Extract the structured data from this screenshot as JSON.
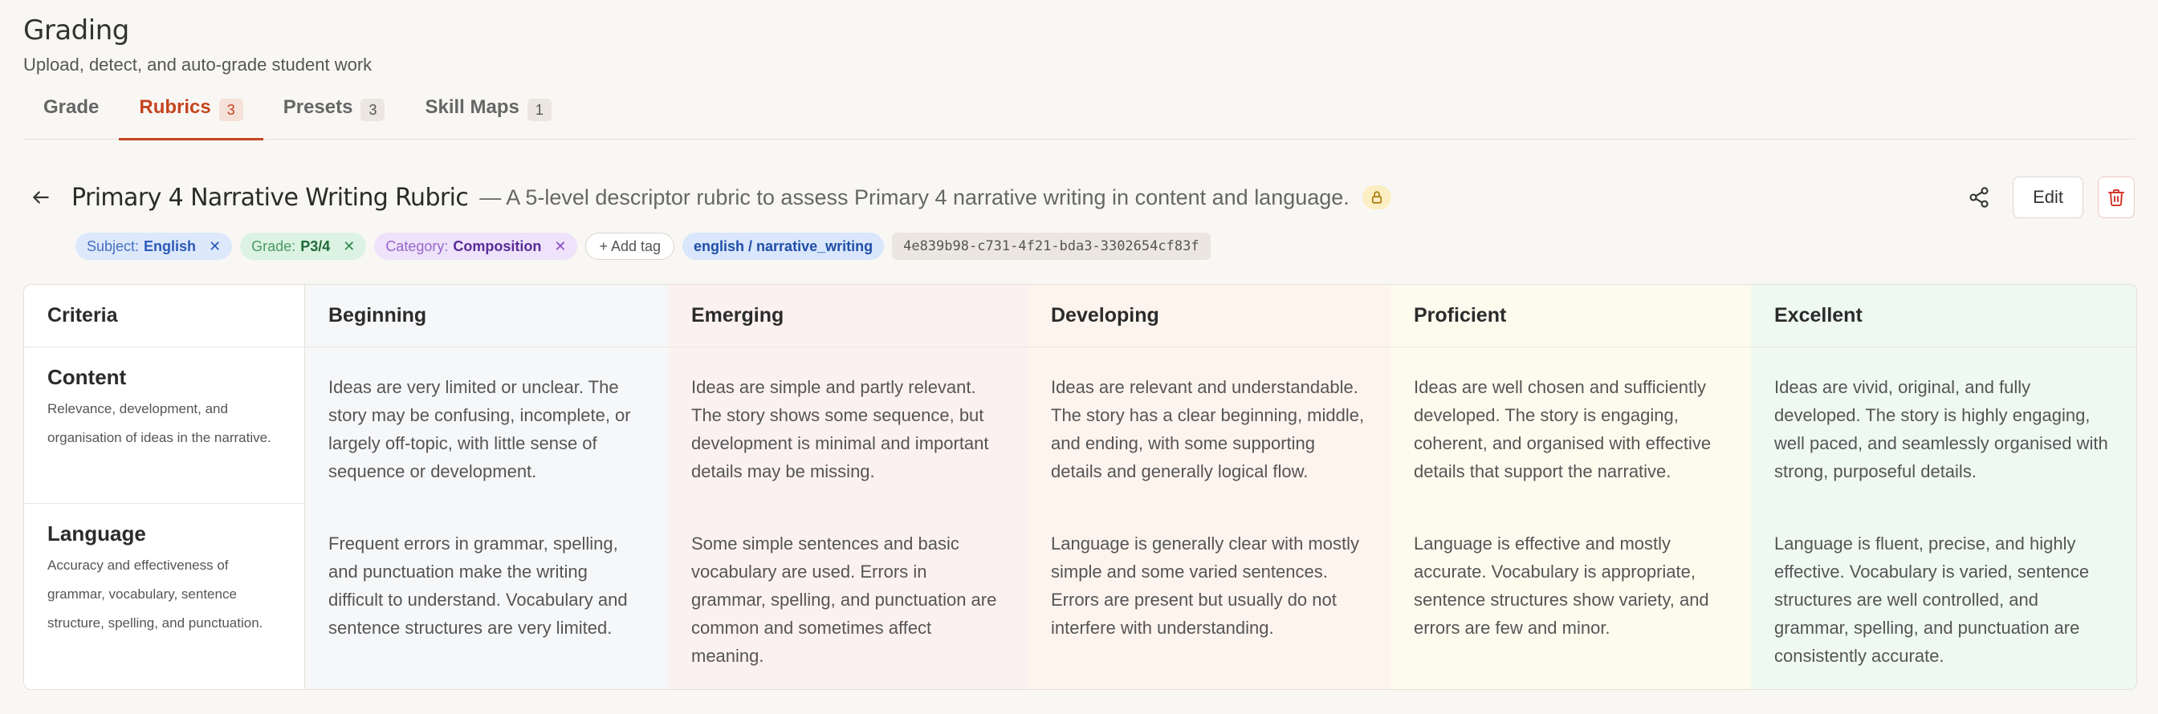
{
  "app": {
    "title": "Grading",
    "subtitle": "Upload, detect, and auto-grade student work"
  },
  "tabs": [
    {
      "label": "Grade",
      "count": null,
      "active": false
    },
    {
      "label": "Rubrics",
      "count": "3",
      "active": true
    },
    {
      "label": "Presets",
      "count": "3",
      "active": false
    },
    {
      "label": "Skill Maps",
      "count": "1",
      "active": false
    }
  ],
  "rubric": {
    "title": "Primary 4 Narrative Writing Rubric",
    "description": "— A 5-level descriptor rubric to assess Primary 4 narrative writing in content and language.",
    "edit_label": "Edit"
  },
  "tags": {
    "subject": {
      "key": "Subject:",
      "value": "English"
    },
    "grade": {
      "key": "Grade:",
      "value": "P3/4"
    },
    "category": {
      "key": "Category:",
      "value": "Composition"
    },
    "add_label": "+ Add tag",
    "path": "english / narrative_writing",
    "uuid": "4e839b98-c731-4f21-bda3-3302654cf83f"
  },
  "table": {
    "headers": [
      "Criteria",
      "Beginning",
      "Emerging",
      "Developing",
      "Proficient",
      "Excellent"
    ],
    "rows": [
      {
        "name": "Content",
        "description": "Relevance, development, and organisation of ideas in the narrative.",
        "cells": [
          "Ideas are very limited or unclear. The story may be confusing, incomplete, or largely off-topic, with little sense of sequence or development.",
          "Ideas are simple and partly relevant. The story shows some sequence, but development is minimal and important details may be missing.",
          "Ideas are relevant and understandable. The story has a clear beginning, middle, and ending, with some supporting details and generally logical flow.",
          "Ideas are well chosen and sufficiently developed. The story is engaging, coherent, and organised with effective details that support the narrative.",
          "Ideas are vivid, original, and fully developed. The story is highly engaging, well paced, and seamlessly organised with strong, purposeful details."
        ]
      },
      {
        "name": "Language",
        "description": "Accuracy and effectiveness of grammar, vocabulary, sentence structure, spelling, and punctuation.",
        "cells": [
          "Frequent errors in grammar, spelling, and punctuation make the writing difficult to understand. Vocabulary and sentence structures are very limited.",
          "Some simple sentences and basic vocabulary are used. Errors in grammar, spelling, and punctuation are common and sometimes affect meaning.",
          "Language is generally clear with mostly simple and some varied sentences. Errors are present but usually do not interfere with understanding.",
          "Language is effective and mostly accurate. Vocabulary is appropriate, sentence structures show variety, and errors are few and minor.",
          "Language is fluent, precise, and highly effective. Vocabulary is varied, sentence structures are well controlled, and grammar, spelling, and punctuation are consistently accurate."
        ]
      }
    ]
  },
  "colors": {
    "accent": "#c4451f",
    "beginning": "#f6f7f9",
    "emerging": "#fcf1f1",
    "developing": "#fdf4ee",
    "proficient": "#fdfbee",
    "excellent": "#eef9f2"
  },
  "icons": {
    "back": "arrow-left-icon",
    "lock": "lock-icon",
    "share": "share-icon",
    "delete": "trash-icon"
  }
}
